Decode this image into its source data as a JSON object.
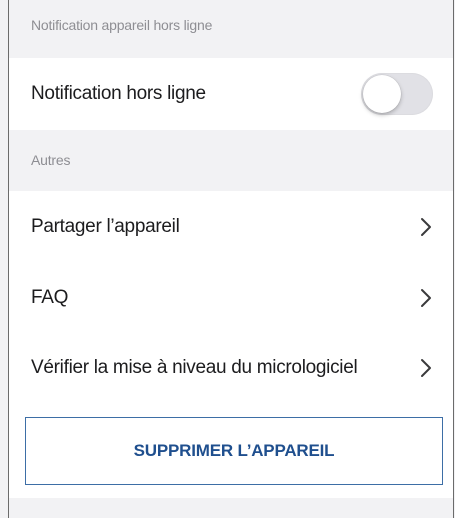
{
  "offline_section": {
    "header": "Notification appareil hors ligne",
    "offline_notification": {
      "label": "Notification hors ligne",
      "toggle_on": false,
      "toggle_off_color": "#e1e1e6"
    }
  },
  "others_section": {
    "header": "Autres",
    "items": [
      {
        "label": "Partager l’appareil",
        "icon": "chevron-right-icon"
      },
      {
        "label": "FAQ",
        "icon": "chevron-right-icon"
      },
      {
        "label": "Vérifier la mise à niveau du micrologiciel",
        "icon": "chevron-right-icon"
      }
    ]
  },
  "delete_button": {
    "label": "SUPPRIMER L’APPAREIL",
    "color": "#1f4f8e"
  }
}
